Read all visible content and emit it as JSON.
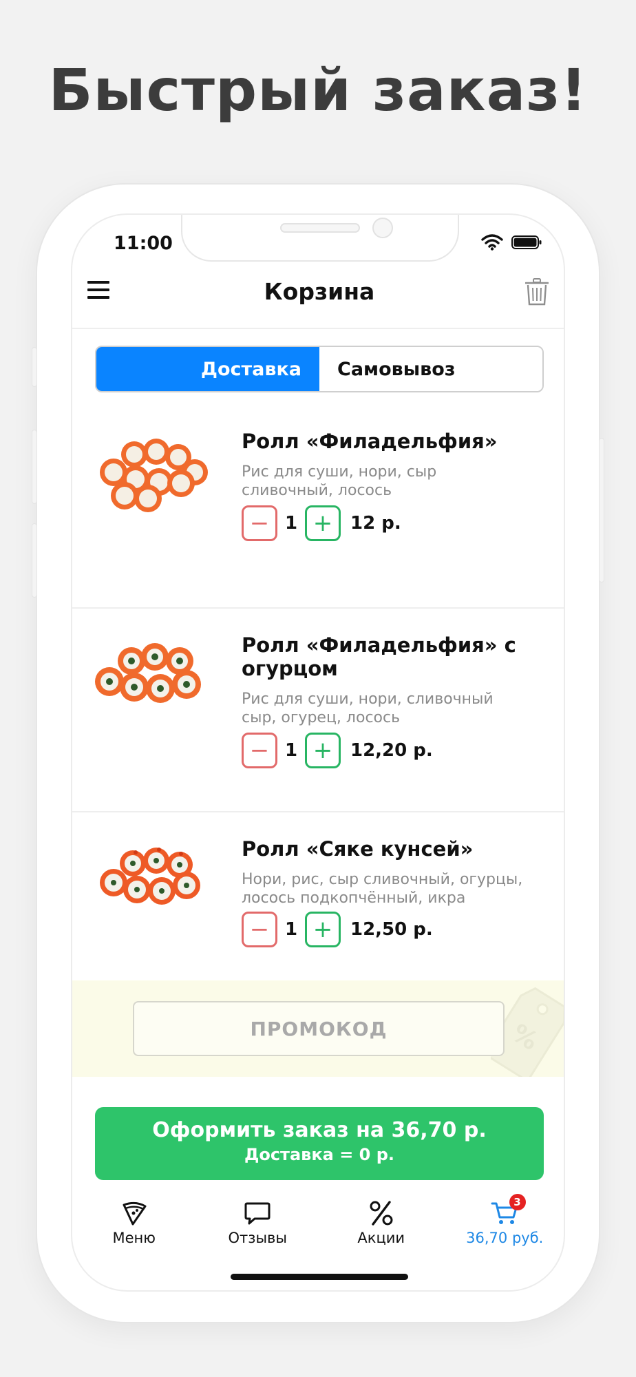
{
  "headline": "Быстрый заказ!",
  "status_bar": {
    "time": "11:00",
    "wifi_icon": "wifi-icon",
    "battery_icon": "battery-icon"
  },
  "nav": {
    "title": "Корзина",
    "menu_icon": "hamburger-menu-icon",
    "trash_icon": "trash-icon"
  },
  "delivery_toggle": {
    "delivery": "Доставка",
    "pickup": "Самовывоз",
    "selected": "delivery",
    "accent": "#0a84ff"
  },
  "cart_items": [
    {
      "name": "Ролл «Филадельфия»",
      "description": "Рис для суши, нори, сыр сливочный, лосось",
      "quantity": "1",
      "price": "12 р."
    },
    {
      "name": "Ролл «Филадельфия» с огурцом",
      "description": "Рис для суши, нори, сливочный сыр, огурец, лосось",
      "quantity": "1",
      "price": "12,20 р."
    },
    {
      "name": "Ролл «Сяке кунсей»",
      "description": "Нори, рис, сыр сливочный, огурцы, лосось подкопчённый, икра",
      "quantity": "1",
      "price": "12,50 р."
    }
  ],
  "promo": {
    "placeholder": "ПРОМОКОД",
    "icon": "discount-tag-icon"
  },
  "checkout": {
    "label": "Оформить заказ на 36,70 р.",
    "delivery_cost": "Доставка = 0 р.",
    "color": "#2ec46a"
  },
  "tabbar": [
    {
      "label": "Меню",
      "icon": "pizza-slice-icon"
    },
    {
      "label": "Отзывы",
      "icon": "chat-bubble-icon"
    },
    {
      "label": "Акции",
      "icon": "percent-icon"
    },
    {
      "label": "36,70 руб.",
      "icon": "cart-icon",
      "badge": "3",
      "active": true
    }
  ],
  "colors": {
    "minus": "#e26a6a",
    "plus": "#28b563",
    "active_tab": "#1e88e5",
    "badge": "#e52222"
  }
}
